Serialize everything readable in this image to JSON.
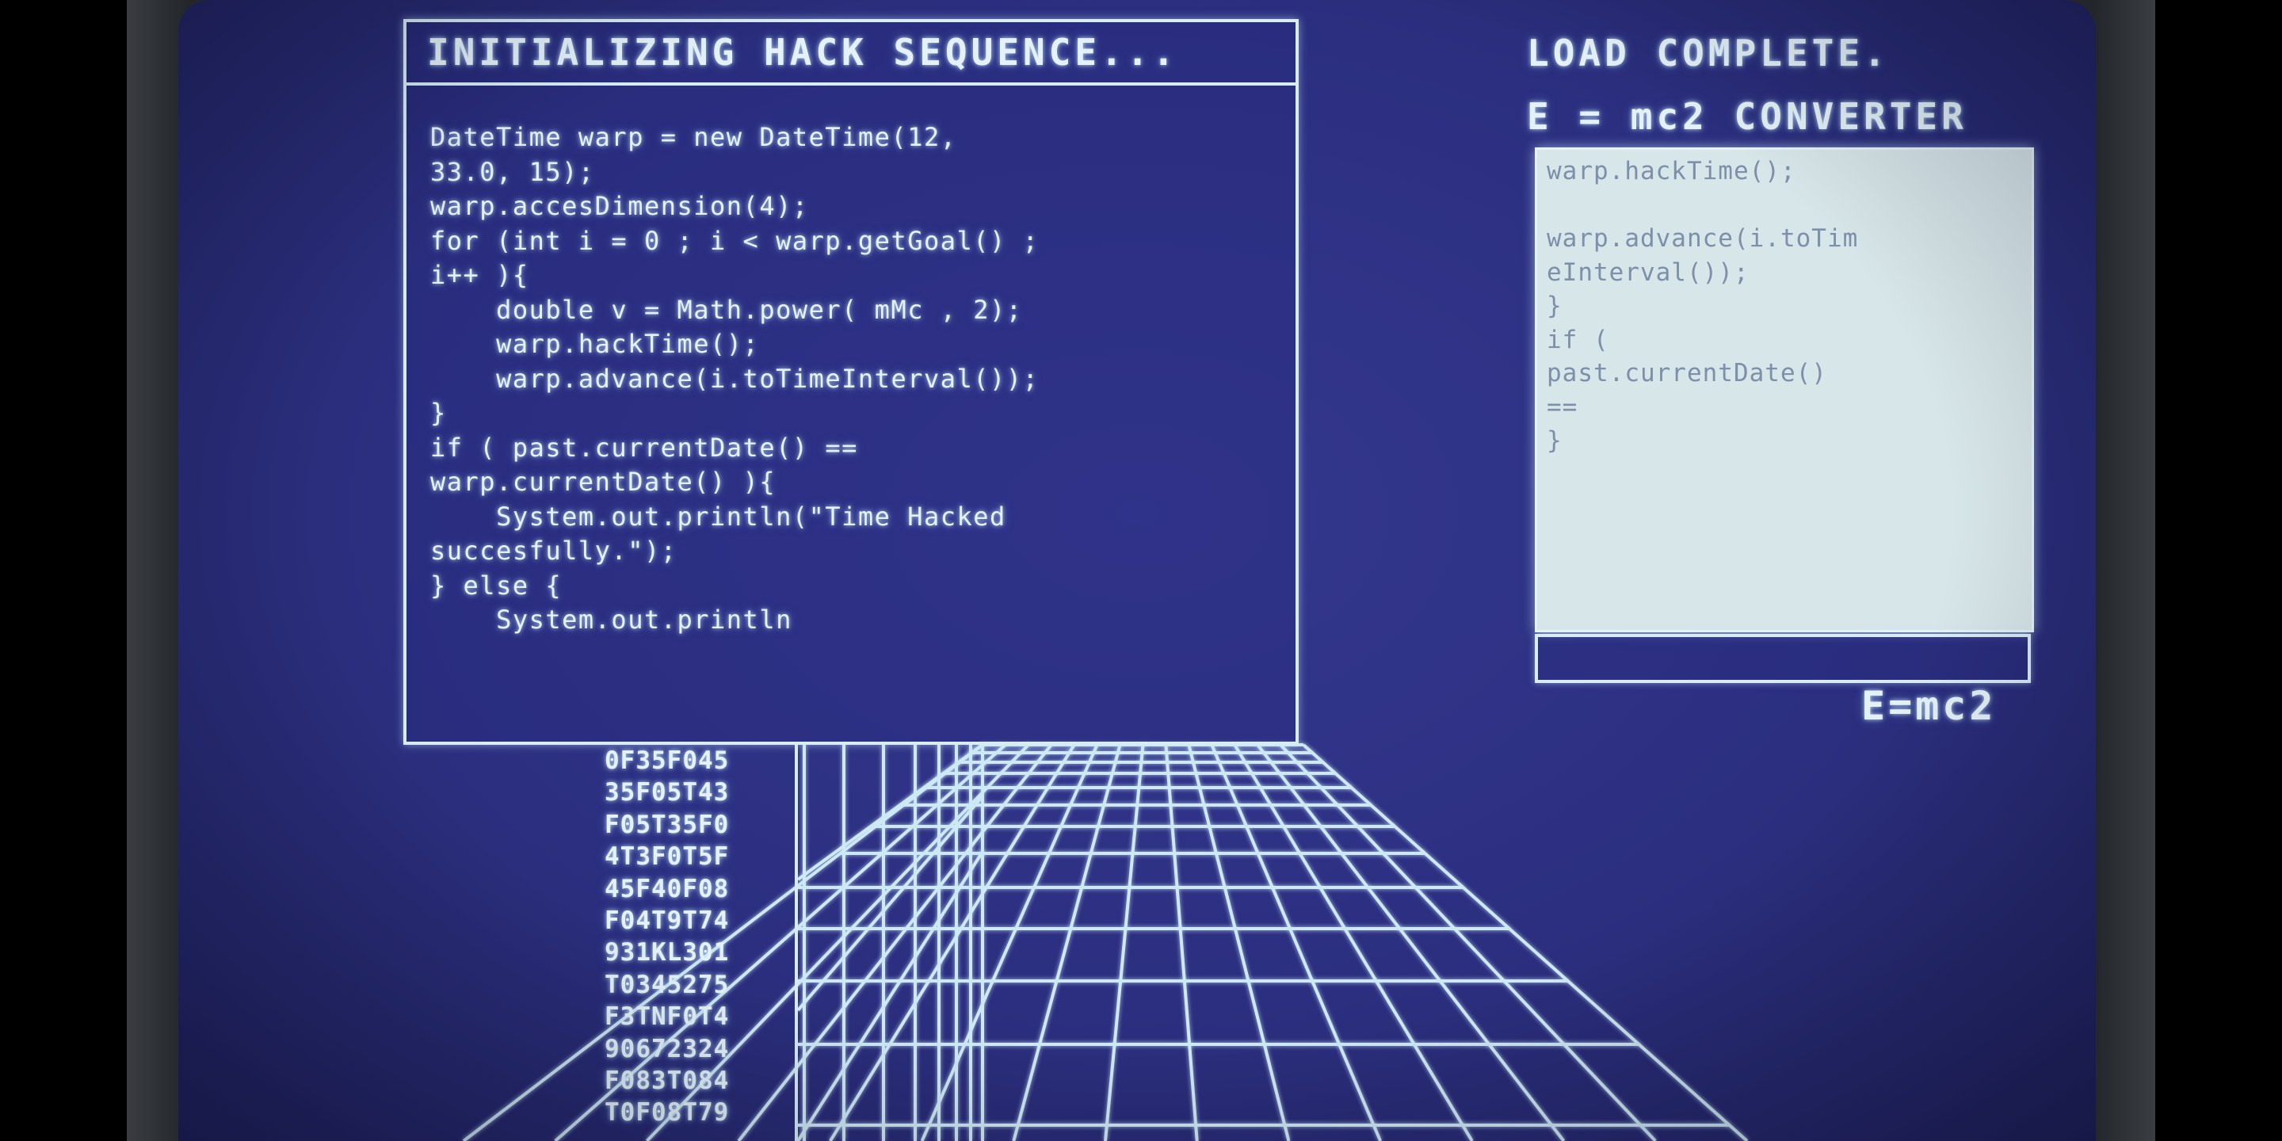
{
  "code_window": {
    "title": "INITIALIZING HACK SEQUENCE...",
    "lines": [
      "DateTime warp = new DateTime(12,",
      "33.0, 15);",
      "warp.accesDimension(4);",
      "for (int i = 0 ; i < warp.getGoal() ;",
      "i++ ){",
      "    double v = Math.power( mMc , 2);",
      "    warp.hackTime();",
      "    warp.advance(i.toTimeInterval());",
      "}",
      "if ( past.currentDate() ==",
      "warp.currentDate() ){",
      "    System.out.println(\"Time Hacked",
      "succesfully.\");",
      "} else {",
      "    System.out.println"
    ]
  },
  "hex_column": [
    "0F35F045",
    "35F05T43",
    "F05T35F0",
    "4T3F0T5F",
    "45F40F08",
    "F04T9T74",
    "931KL301",
    "T0345275",
    "F3TNF0T4",
    "90672324",
    "F083T084",
    "T0F08T79"
  ],
  "converter": {
    "status": "LOAD COMPLETE.",
    "title": "E = mc2 CONVERTER",
    "output_lines": [
      "warp.hackTime();",
      "",
      "warp.advance(i.toTim",
      "eInterval());",
      "}",
      "if (",
      "past.currentDate()",
      "==",
      "}"
    ],
    "input_value": "",
    "formula_label": "E=mc2"
  },
  "colors": {
    "screen_bg": "#2c2f80",
    "phosphor": "#e4f2f8",
    "panel_bg": "#d7e6e9",
    "panel_text": "#7d8fa9"
  }
}
